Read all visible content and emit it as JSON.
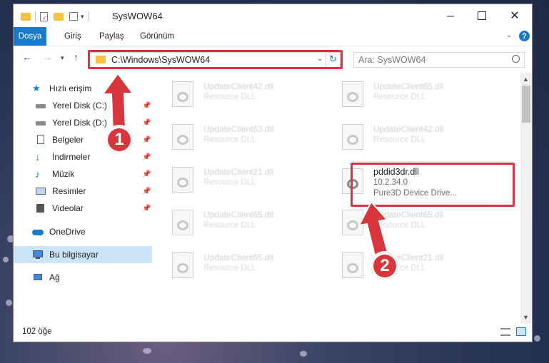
{
  "window": {
    "title": "SysWOW64"
  },
  "ribbon": {
    "tabs": [
      "Dosya",
      "Giriş",
      "Paylaş",
      "Görünüm"
    ]
  },
  "address": {
    "path": "C:\\Windows\\SysWOW64"
  },
  "search": {
    "placeholder": "Ara: SysWOW64"
  },
  "nav": {
    "items": [
      {
        "label": "Hızlı erişim"
      },
      {
        "label": "Yerel Disk (C:)"
      },
      {
        "label": "Yerel Disk (D:)"
      },
      {
        "label": "Belgeler"
      },
      {
        "label": "İndirmeler"
      },
      {
        "label": "Müzik"
      },
      {
        "label": "Resimler"
      },
      {
        "label": "Videolar"
      },
      {
        "label": "OneDrive"
      },
      {
        "label": "Bu bilgisayar"
      },
      {
        "label": "Ağ"
      }
    ]
  },
  "files": [
    {
      "name": "UpdateClient42.dll",
      "desc": "Resource DLL"
    },
    {
      "name": "UpdateClient65.dll",
      "desc": "Resource DLL"
    },
    {
      "name": "UpdateClient63.dll",
      "desc": "Resource DLL"
    },
    {
      "name": "UpdateClient42.dll",
      "desc": "Resource DLL"
    },
    {
      "name": "UpdateClient21.dll",
      "desc": "Resource DLL"
    },
    {
      "name": "pddid3dr.dll",
      "version": "10.2.34.0",
      "desc": "Pure3D Device Drive..."
    },
    {
      "name": "UpdateClient65.dll",
      "desc": "Resource DLL"
    },
    {
      "name": "UpdateClient65.dll",
      "desc": "Resource DLL"
    },
    {
      "name": "UpdateClient65.dll",
      "desc": "Resource DLL"
    },
    {
      "name": "UpdateClient21.dll",
      "desc": "Resource DLL"
    }
  ],
  "status": {
    "count": "102 öğe"
  },
  "badges": {
    "one": "1",
    "two": "2"
  },
  "colors": {
    "accent": "#1979ca",
    "highlight": "#d9353c",
    "selection": "#cce4f7"
  }
}
